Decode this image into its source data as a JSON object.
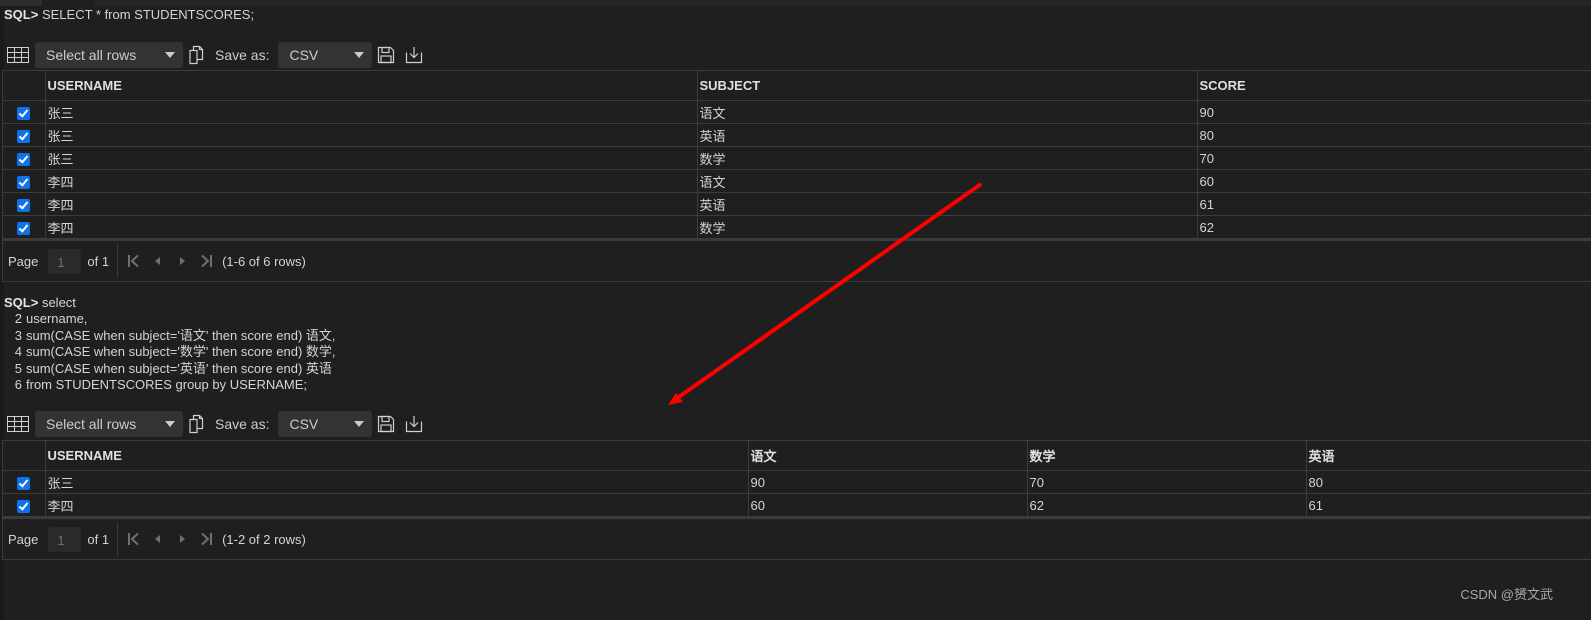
{
  "queries": [
    {
      "prompt": "SQL>",
      "lines": [
        "SELECT * from STUDENTSCORES;"
      ],
      "toolbar": {
        "row_select": "Select all rows",
        "save_as_label": "Save as:",
        "format": "CSV"
      },
      "columns": [
        "USERNAME",
        "SUBJECT",
        "SCORE"
      ],
      "rows": [
        {
          "checked": true,
          "cells": [
            "张三",
            "语文",
            "90"
          ]
        },
        {
          "checked": true,
          "cells": [
            "张三",
            "英语",
            "80"
          ]
        },
        {
          "checked": true,
          "cells": [
            "张三",
            "数学",
            "70"
          ]
        },
        {
          "checked": true,
          "cells": [
            "李四",
            "语文",
            "60"
          ]
        },
        {
          "checked": true,
          "cells": [
            "李四",
            "英语",
            "61"
          ]
        },
        {
          "checked": true,
          "cells": [
            "李四",
            "数学",
            "62"
          ]
        }
      ],
      "pager": {
        "page_label": "Page",
        "page": "1",
        "of_label": "of 1",
        "summary": "(1-6 of 6 rows)"
      }
    },
    {
      "prompt": "SQL>",
      "lines": [
        "select",
        "username,",
        "sum(CASE when subject='语文' then score end) 语文,",
        "sum(CASE when subject='数学' then score end) 数学,",
        "sum(CASE when subject='英语' then score end) 英语",
        "from STUDENTSCORES group by USERNAME;"
      ],
      "line_numbers": [
        "2",
        "3",
        "4",
        "5",
        "6"
      ],
      "toolbar": {
        "row_select": "Select all rows",
        "save_as_label": "Save as:",
        "format": "CSV"
      },
      "columns": [
        "USERNAME",
        "语文",
        "数学",
        "英语"
      ],
      "rows": [
        {
          "checked": true,
          "cells": [
            "张三",
            "90",
            "70",
            "80"
          ]
        },
        {
          "checked": true,
          "cells": [
            "李四",
            "60",
            "62",
            "61"
          ]
        }
      ],
      "pager": {
        "page_label": "Page",
        "page": "1",
        "of_label": "of 1",
        "summary": "(1-2 of 2 rows)"
      }
    }
  ],
  "watermark": "CSDN @赟文武",
  "colors": {
    "background": "#1f1f1f",
    "checkbox": "#0e72ed",
    "annotation_arrow": "#ff0000"
  }
}
